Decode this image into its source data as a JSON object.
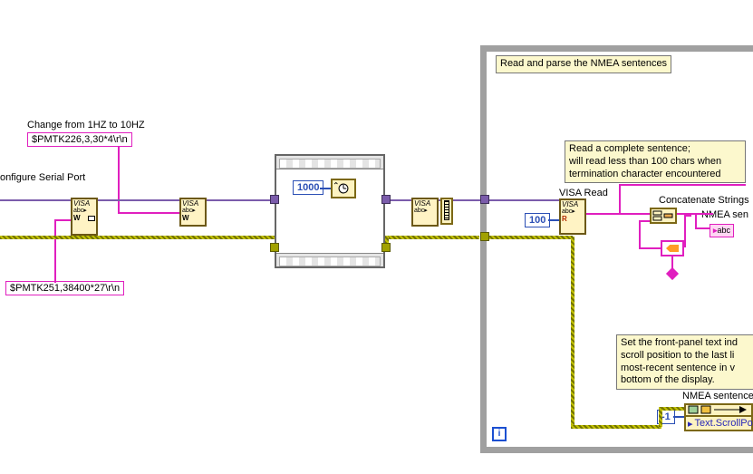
{
  "labels": {
    "change_rate": "Change from 1HZ to 10HZ",
    "configure_port": "onfigure Serial Port",
    "visa_read": "VISA Read",
    "concat_strings": "Concatenate Strings",
    "nmea_sen_out": "NMEA sen",
    "nmea_sentence": "NMEA sentence",
    "text_scrollpos": "Text.ScrollPos"
  },
  "constants": {
    "pmtk226": "$PMTK226,3,30*4\\r\\n",
    "pmtk251": "$PMTK251,38400*27\\r\\n",
    "delay_ms": "1000",
    "read_bytes": "100",
    "neg_one": "-1",
    "abc": "abc"
  },
  "comments": {
    "loop_title": "Read and parse the NMEA sentences",
    "read_complete": "Read a complete sentence;\nwill read less than 100 chars when\ntermination character encountered",
    "front_panel": "Set the front-panel text ind\nscroll position to the last li\nmost-recent sentence in v\nbottom of the display."
  },
  "nodes": {
    "visa": "VISA",
    "abc": "abc",
    "write": "W",
    "read": "R"
  },
  "icons": {
    "loop_i": "i"
  }
}
